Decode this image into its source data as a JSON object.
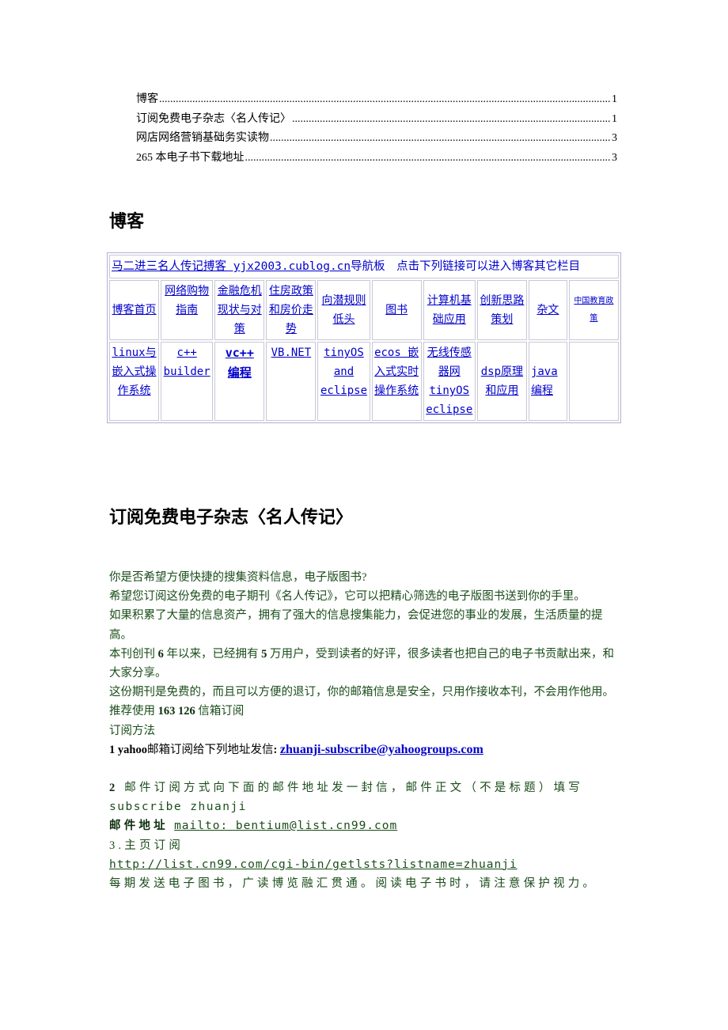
{
  "toc": [
    {
      "title": "博客",
      "page": "1"
    },
    {
      "title": "订阅免费电子杂志〈名人传记〉",
      "page": "1"
    },
    {
      "title": "网店网络营销基础务实读物",
      "page": "3"
    },
    {
      "title": "265 本电子书下载地址",
      "page": "3"
    }
  ],
  "blog": {
    "heading": "博客",
    "nav_header_link": "马二进三名人传记搏客 yjx2003.cublog.cn",
    "nav_header_rest": "导航板　点击下列链接可以进入博客其它栏目",
    "row1": [
      "博客首页",
      "网络购物指南",
      "金融危机现状与对策",
      "住房政策和房价走势",
      "向潜规则低头",
      "图书",
      "计算机基础应用",
      "创新思路策划",
      "杂文",
      "中国教育政策"
    ],
    "row2": [
      "linux与嵌入式操作系统",
      "c++ builder",
      "vc++ 编程",
      "VB.NET",
      "tinyOS and eclipse",
      "ecos 嵌入式实时操作系统",
      "无线传感器网 tinyOS eclipse",
      "dsp原理和应用",
      "java 编程",
      ""
    ]
  },
  "subscribe": {
    "heading": "订阅免费电子杂志〈名人传记〉",
    "p1": "你是否希望方便快捷的搜集资料信息，电子版图书?",
    "p2": "希望您订阅这份免费的电子期刊《名人传记》，它可以把精心筛选的电子版图书送到你的手里。",
    "p3": "如果积累了大量的信息资产，拥有了强大的信息搜集能力，会促进您的事业的发展，生活质量的提高。",
    "p4_a": "本刊创刊 ",
    "p4_years": "6",
    "p4_b": " 年以来，已经拥有 ",
    "p4_users": "5",
    "p4_c": " 万用户，受到读者的好评，很多读者也把自己的电子书贡献出来，和大家分享。",
    "p5": "这份期刊是免费的，而且可以方便的退订，你的邮箱信息是安全，只用作接收本刊，不会用作他用。",
    "p6_a": "推荐使用 ",
    "p6_b": "163 126",
    "p6_c": " 信箱订阅",
    "p7": "订阅方法",
    "m1_num": "1 yahoo",
    "m1_text": "邮箱订阅给下列地址发信",
    "m1_colon": ": ",
    "m1_email": "zhuanji-subscribe@yahoogroups.com",
    "m2_num": "2",
    "m2_text": " 邮件订阅方式向下面的邮件地址发一封信，邮件正文（不是标题）填写",
    "m2_body": "subscribe zhuanji",
    "m2_addr_label": "邮件地址",
    "m2_addr": "mailto: bentium@list.cn99.com",
    "m3_label": "3.主页订阅",
    "m3_url": "http://list.cn99.com/cgi-bin/getlsts?listname=zhuanji",
    "closing": "每期发送电子图书，广读博览融汇贯通。阅读电子书时，请注意保护视力。"
  }
}
